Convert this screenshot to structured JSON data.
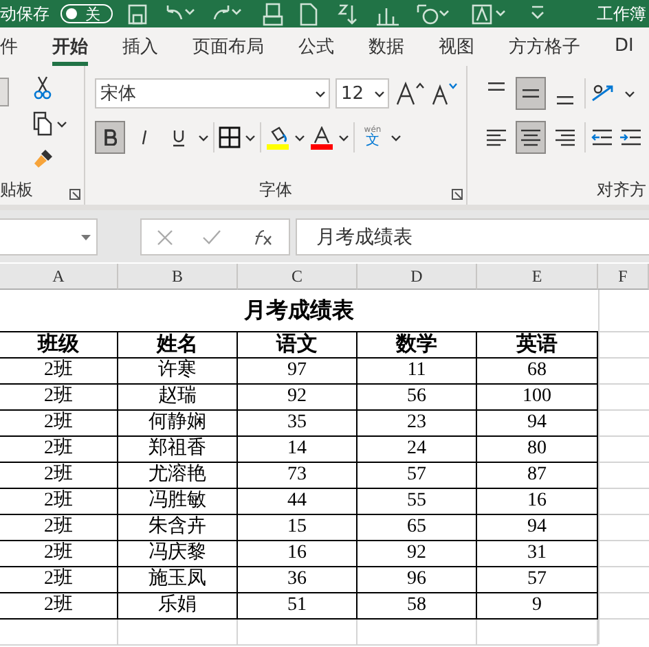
{
  "title_bar": {
    "autosave_label": "动保存",
    "autosave_toggle": {
      "label": "关",
      "on": false
    },
    "document_title": "工作簿"
  },
  "tabs": [
    {
      "label": "件",
      "selected": false
    },
    {
      "label": "开始",
      "selected": true
    },
    {
      "label": "插入",
      "selected": false
    },
    {
      "label": "页面布局",
      "selected": false
    },
    {
      "label": "公式",
      "selected": false
    },
    {
      "label": "数据",
      "selected": false
    },
    {
      "label": "视图",
      "selected": false
    },
    {
      "label": "方方格子",
      "selected": false
    },
    {
      "label": "DI",
      "selected": false
    }
  ],
  "ribbon": {
    "clipboard": {
      "group_label": "贴板"
    },
    "font": {
      "font_name": "宋体",
      "font_size": "12",
      "bold": {
        "on": true
      },
      "italic": {
        "on": false
      },
      "underline": {
        "on": false
      },
      "color_buttons": [
        {
          "kind": "highlight",
          "color": "#ffff00"
        },
        {
          "kind": "font",
          "color": "#ff0000"
        }
      ],
      "phonetic": {
        "pinyin": "wén",
        "char": "文"
      },
      "group_label": "字体"
    },
    "alignment": {
      "vertical": [
        {
          "selected": false
        },
        {
          "selected": true
        },
        {
          "selected": false
        }
      ],
      "horizontal": [
        {
          "selected": false
        },
        {
          "selected": true
        },
        {
          "selected": false
        }
      ],
      "group_label": "对齐方"
    }
  },
  "formula_bar": {
    "formula": "月考成绩表"
  },
  "sheet": {
    "columns": [
      "A",
      "B",
      "C",
      "D",
      "E",
      "F"
    ],
    "title": "月考成绩表",
    "header": [
      "班级",
      "姓名",
      "语文",
      "数学",
      "英语"
    ],
    "rows": [
      [
        "2班",
        "许寒",
        "97",
        "11",
        "68"
      ],
      [
        "2班",
        "赵瑞",
        "92",
        "56",
        "100"
      ],
      [
        "2班",
        "何静娴",
        "35",
        "23",
        "94"
      ],
      [
        "2班",
        "郑祖香",
        "14",
        "24",
        "80"
      ],
      [
        "2班",
        "尤溶艳",
        "73",
        "57",
        "87"
      ],
      [
        "2班",
        "冯胜敏",
        "44",
        "55",
        "16"
      ],
      [
        "2班",
        "朱含卉",
        "15",
        "65",
        "94"
      ],
      [
        "2班",
        "冯庆黎",
        "16",
        "92",
        "31"
      ],
      [
        "2班",
        "施玉凤",
        "36",
        "96",
        "57"
      ],
      [
        "2班",
        "乐娟",
        "51",
        "58",
        "9"
      ]
    ]
  }
}
